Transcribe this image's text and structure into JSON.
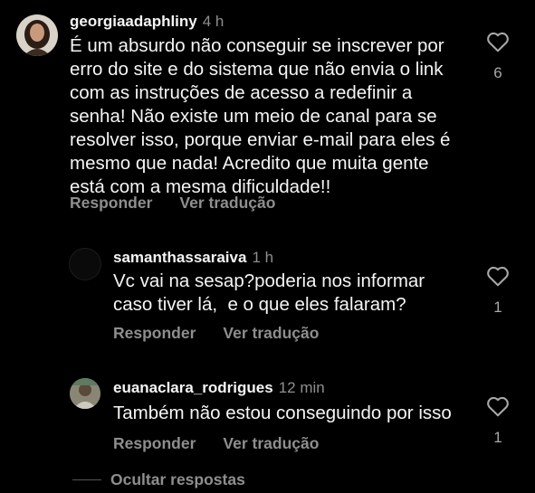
{
  "comments": [
    {
      "username": "georgiaadaphliny",
      "time": "4 h",
      "text": "É um absurdo não conseguir se inscrever por\nerro do site e do sistema que não envia o link\ncom as instruções de acesso a redefinir a\nsenha! Não existe um meio de canal para se\nresolver isso, porque enviar e-mail para eles é\nmesmo que nada! Acredito que muita gente\nestá com a mesma dificuldade!!",
      "reply_label": "Responder",
      "translate_label": "Ver tradução",
      "likes": "6"
    },
    {
      "username": "samanthassaraiva",
      "time": "1 h",
      "text": "Vc vai na sesap?poderia nos informar\ncaso tiver lá,  e o que eles falaram?",
      "reply_label": "Responder",
      "translate_label": "Ver tradução",
      "likes": "1"
    },
    {
      "username": "euanaclara_rodrigues",
      "time": "12 min",
      "text": "Também não estou conseguindo por isso",
      "reply_label": "Responder",
      "translate_label": "Ver tradução",
      "likes": "1"
    }
  ],
  "hide_replies_label": "Ocultar respostas",
  "icons": {
    "like": "heart-outline-icon",
    "avatar": "user-avatar"
  },
  "colors": {
    "background": "#000000",
    "text": "#f5f5f5",
    "secondary": "#8e8e8e"
  }
}
